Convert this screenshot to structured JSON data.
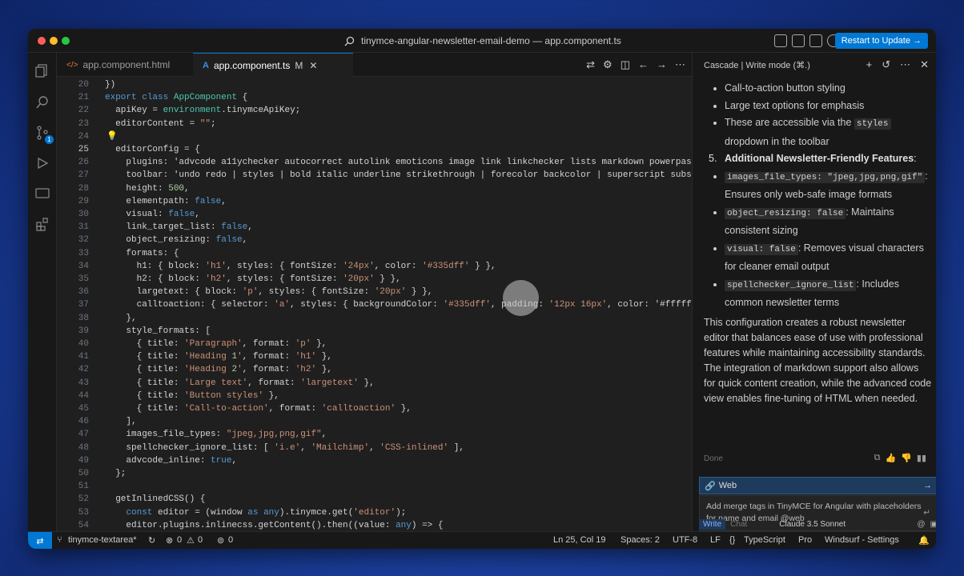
{
  "window": {
    "title": "tinymce-angular-newsletter-email-demo — app.component.ts"
  },
  "titlebar": {
    "restart_label": "Restart to Update →"
  },
  "activity": {
    "scm_badge": "1"
  },
  "tabs": [
    {
      "icon": "</>",
      "label": "app.component.html"
    },
    {
      "icon": "A",
      "label": "app.component.ts",
      "modified": "M"
    }
  ],
  "editor": {
    "lines": [
      {
        "n": "20",
        "text": "})"
      },
      {
        "n": "21",
        "text": "export class AppComponent {"
      },
      {
        "n": "22",
        "text": "  apiKey = environment.tinymceApiKey;"
      },
      {
        "n": "23",
        "text": "  editorContent = \"\";"
      },
      {
        "n": "24",
        "text": ""
      },
      {
        "n": "25",
        "text": "  editorConfig = {"
      },
      {
        "n": "26",
        "text": "    plugins: 'advcode a11ychecker autocorrect autolink emoticons image link linkchecker lists markdown powerpaste"
      },
      {
        "n": "27",
        "text": "    toolbar: 'undo redo | styles | bold italic underline strikethrough | forecolor backcolor | superscript subsc"
      },
      {
        "n": "28",
        "text": "    height: 500,"
      },
      {
        "n": "29",
        "text": "    elementpath: false,"
      },
      {
        "n": "30",
        "text": "    visual: false,"
      },
      {
        "n": "31",
        "text": "    link_target_list: false,"
      },
      {
        "n": "32",
        "text": "    object_resizing: false,"
      },
      {
        "n": "33",
        "text": "    formats: {"
      },
      {
        "n": "34",
        "text": "      h1: { block: 'h1', styles: { fontSize: '24px', color: '#335dff' } },"
      },
      {
        "n": "35",
        "text": "      h2: { block: 'h2', styles: { fontSize: '20px' } },"
      },
      {
        "n": "36",
        "text": "      largetext: { block: 'p', styles: { fontSize: '20px' } },"
      },
      {
        "n": "37",
        "text": "      calltoaction: { selector: 'a', styles: { backgroundColor: '#335dff', padding: '12px 16px', color: '#ffffff"
      },
      {
        "n": "38",
        "text": "    },"
      },
      {
        "n": "39",
        "text": "    style_formats: ["
      },
      {
        "n": "40",
        "text": "      { title: 'Paragraph', format: 'p' },"
      },
      {
        "n": "41",
        "text": "      { title: 'Heading 1', format: 'h1' },"
      },
      {
        "n": "42",
        "text": "      { title: 'Heading 2', format: 'h2' },"
      },
      {
        "n": "43",
        "text": "      { title: 'Large text', format: 'largetext' },"
      },
      {
        "n": "44",
        "text": "      { title: 'Button styles' },"
      },
      {
        "n": "45",
        "text": "      { title: 'Call-to-action', format: 'calltoaction' },"
      },
      {
        "n": "46",
        "text": "    ],"
      },
      {
        "n": "47",
        "text": "    images_file_types: \"jpeg,jpg,png,gif\","
      },
      {
        "n": "48",
        "text": "    spellchecker_ignore_list: [ 'i.e', 'Mailchimp', 'CSS-inlined' ],"
      },
      {
        "n": "49",
        "text": "    advcode_inline: true,"
      },
      {
        "n": "50",
        "text": "  };"
      },
      {
        "n": "51",
        "text": ""
      },
      {
        "n": "52",
        "text": "  getInlinedCSS() {"
      },
      {
        "n": "53",
        "text": "    const editor = (window as any).tinymce.get('editor');"
      },
      {
        "n": "54",
        "text": "    editor.plugins.inlinecss.getContent().then((value: any) => {"
      }
    ]
  },
  "panel": {
    "header": "Cascade | Write mode (⌘.)",
    "bullets1": [
      "Call-to-action button styling",
      "Large text options for emphasis"
    ],
    "bullet_styles_pre": "These are accessible via the",
    "bullet_styles_code": "styles",
    "bullet_styles_post": "dropdown in the toolbar",
    "item5_num": "5.",
    "item5_title": "Additional Newsletter-Friendly Features",
    "item5_colon": ":",
    "sub": [
      {
        "code": "images_file_types: \"jpeg,jpg,png,gif\"",
        "text": ": Ensures only web-safe image formats"
      },
      {
        "code": "object_resizing: false",
        "text": ": Maintains consistent sizing"
      },
      {
        "code": "visual: false",
        "text": ": Removes visual characters for cleaner email output"
      },
      {
        "code": "spellchecker_ignore_list",
        "text": ": Includes common newsletter terms"
      }
    ],
    "paragraph": "This configuration creates a robust newsletter editor that balances ease of use with professional features while maintaining accessibility standards. The integration of markdown support also allows for quick content creation, while the advanced code view enables fine-tuning of HTML when needed.",
    "done": "Done",
    "web_label": "Web",
    "input_text": "Add merge tags in TinyMCE for Angular with placeholders for name and email @web",
    "write_label": "Write",
    "chat_label": "Chat",
    "model": "Claude 3.5 Sonnet"
  },
  "status": {
    "branch": "tinymce-textarea*",
    "errors": "0",
    "warnings": "0",
    "ports": "0",
    "position": "Ln 25, Col 19",
    "spaces": "Spaces: 2",
    "encoding": "UTF-8",
    "eol": "LF",
    "language": "TypeScript",
    "pro": "Pro",
    "settings": "Windsurf - Settings"
  }
}
